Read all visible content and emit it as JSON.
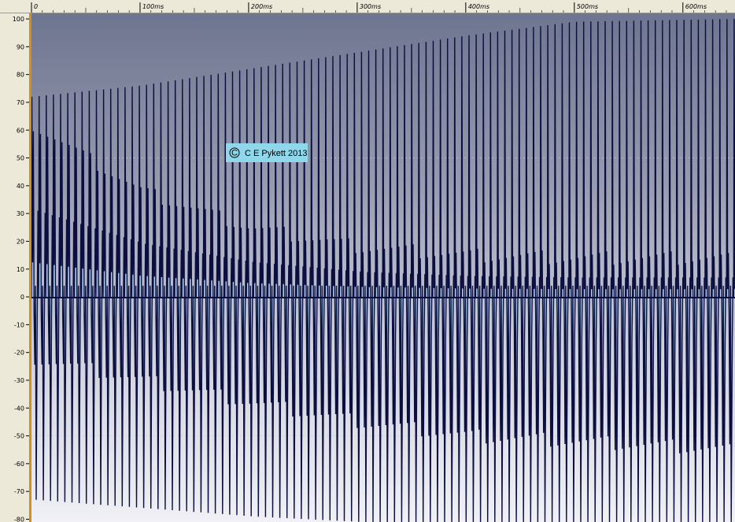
{
  "chart_data": {
    "type": "line",
    "title": "",
    "xlabel": "",
    "ylabel": "",
    "x_unit": "ms",
    "x_ticks": [
      "0",
      "100ms",
      "200ms",
      "300ms",
      "400ms",
      "500ms",
      "600ms"
    ],
    "y_ticks": [
      "100",
      "90",
      "80",
      "70",
      "60",
      "50",
      "40",
      "30",
      "20",
      "10",
      "0",
      "-10",
      "-20",
      "-30",
      "-40",
      "-50",
      "-60",
      "-70",
      "-80"
    ],
    "xlim": [
      0,
      648
    ],
    "ylim": [
      -81,
      102
    ],
    "grid": true,
    "legend": "none",
    "series": [
      {
        "description_of_shape": "periodic waveform",
        "period_ms": 6.6,
        "sample_envelope": {
          "x": [
            0,
            100,
            200,
            300,
            400,
            500,
            648
          ],
          "upper_peak": [
            72,
            76,
            82,
            88,
            94,
            99,
            100
          ],
          "upper_secondary": [
            62,
            38,
            25,
            18,
            15,
            14,
            14
          ],
          "lower_secondary": [
            -22,
            -30,
            -38,
            -45,
            -50,
            -52,
            -55
          ],
          "lower_trough": [
            -73,
            -76,
            -79,
            -81,
            -81,
            -81,
            -81
          ]
        }
      }
    ],
    "colors": {
      "waveform_stroke": "#0a0f40",
      "waveform_fill": "#a8d0f4",
      "background_top": "#6e7590",
      "background_bottom": "#f0f0f6",
      "ruler_background": "#ece9d8"
    }
  },
  "watermark": {
    "symbol": "C",
    "text": "C E Pykett 2013",
    "background": "#8fd8ec"
  }
}
